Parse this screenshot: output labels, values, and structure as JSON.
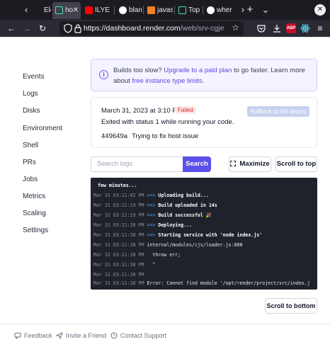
{
  "browser": {
    "tabs": [
      {
        "title": "Elep"
      },
      {
        "title": "ho",
        "active": true
      },
      {
        "title": "ILYE"
      },
      {
        "title": "blam"
      },
      {
        "title": "javas"
      },
      {
        "title": "Top I"
      },
      {
        "title": "wher"
      }
    ],
    "new_tab": "+",
    "tab_list": "⌄",
    "close": "✕",
    "url_host": "https://dashboard.render.com",
    "url_path": "/web/srv-cgjejf64dada",
    "abp_label": "ABP"
  },
  "sidebar": {
    "items": [
      {
        "label": "Events"
      },
      {
        "label": "Logs"
      },
      {
        "label": "Disks"
      },
      {
        "label": "Environment"
      },
      {
        "label": "Shell"
      },
      {
        "label": "PRs"
      },
      {
        "label": "Jobs"
      },
      {
        "label": "Metrics"
      },
      {
        "label": "Scaling"
      },
      {
        "label": "Settings"
      }
    ]
  },
  "banner": {
    "text1": "Builds too slow? ",
    "link1": "Upgrade to a paid plan",
    "text2": " to go faster. Learn more about ",
    "link2": "free instance type limits",
    "text3": "."
  },
  "deploy": {
    "date": "March 31, 2023 at 3:10 PM",
    "status": "Failed",
    "rollback_label": "Rollback to this deploy",
    "exit_message": "Exited with status 1 while running your code.",
    "commit_sha": "449649a",
    "commit_message": "Trying to fix host issue"
  },
  "logs": {
    "search_placeholder": "Search logs",
    "search_label": "Search",
    "maximize_label": "Maximize",
    "scroll_top_label": "Scroll to top",
    "scroll_bottom_label": "Scroll to bottom",
    "lines": [
      {
        "ts": "",
        "arrow": "",
        "msg": "few minutes...",
        "plain": ""
      },
      {
        "ts": "Mar 31 03:11:02 PM",
        "arrow": "==>",
        "msg": "Uploading build...",
        "plain": ""
      },
      {
        "ts": "Mar 31 03:11:19 PM",
        "arrow": "==>",
        "msg": "Build uploaded in 14s",
        "plain": ""
      },
      {
        "ts": "Mar 31 03:11:19 PM",
        "arrow": "==>",
        "msg": "Build successful 🎉",
        "plain": ""
      },
      {
        "ts": "Mar 31 03:11:20 PM",
        "arrow": "==>",
        "msg": "Deploying...",
        "plain": ""
      },
      {
        "ts": "Mar 31 03:11:38 PM",
        "arrow": "==>",
        "msg": "Starting service with 'node index.js'",
        "plain": ""
      },
      {
        "ts": "Mar 31 03:11:38 PM",
        "arrow": "",
        "msg": "",
        "plain": "internal/modules/cjs/loader.js:888"
      },
      {
        "ts": "Mar 31 03:11:38 PM",
        "arrow": "",
        "msg": "",
        "plain": "  throw err;"
      },
      {
        "ts": "Mar 31 03:11:38 PM",
        "arrow": "",
        "msg": "",
        "plain": "  ^"
      },
      {
        "ts": "Mar 31 03:11:38 PM",
        "arrow": "",
        "msg": "",
        "plain": ""
      },
      {
        "ts": "Mar 31 03:11:38 PM",
        "arrow": "",
        "msg": "",
        "plain": "Error: Cannot find module '/opt/render/project/src/index.j"
      }
    ]
  },
  "footer": {
    "feedback": "Feedback",
    "invite": "Invite a Friend",
    "support": "Contact Support"
  },
  "colors": {
    "accent": "#5b50e8",
    "failed": "#dc2626",
    "terminal_bg": "#1f222a"
  }
}
